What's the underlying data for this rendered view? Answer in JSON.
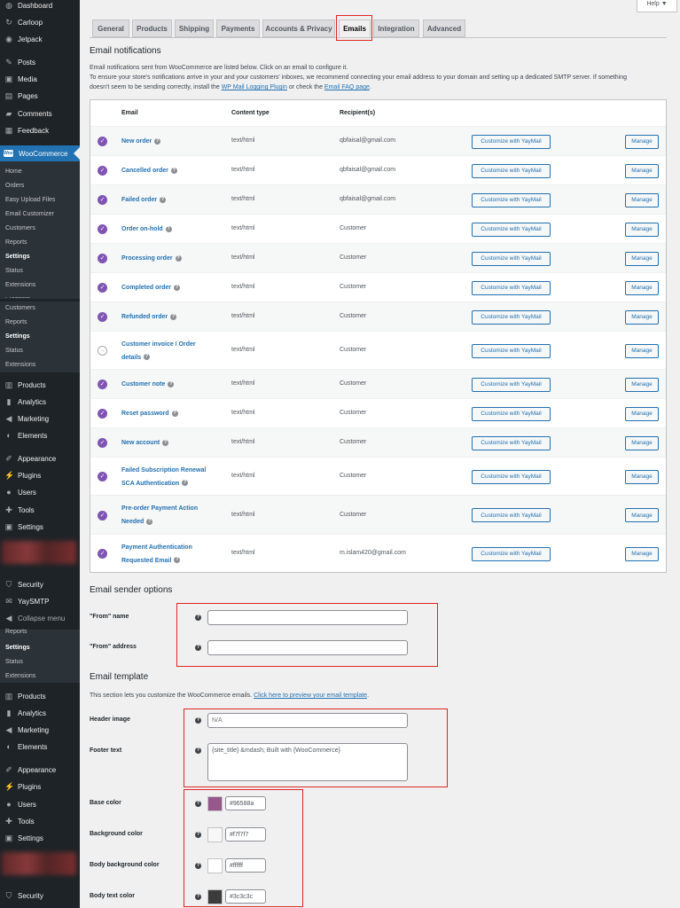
{
  "sidebar": {
    "dashboard": "Dashboard",
    "carloop": "Carloop",
    "jetpack": "Jetpack",
    "posts": "Posts",
    "media": "Media",
    "pages": "Pages",
    "comments": "Comments",
    "feedback": "Feedback",
    "woocommerce": "WooCommerce",
    "woo_icon": "Woo",
    "woo_sub": [
      "Home",
      "Orders",
      "Easy Upload Files",
      "Email Customizer",
      "Customers",
      "Reports",
      "Settings",
      "Status",
      "Extensions"
    ],
    "clip": "Products",
    "sub2": [
      "Customers",
      "Reports",
      "Settings",
      "Status",
      "Extensions"
    ],
    "menu2": [
      "Products",
      "Analytics",
      "Marketing",
      "Elements"
    ],
    "menu3": [
      "Appearance",
      "Plugins",
      "Users",
      "Tools",
      "Settings"
    ],
    "menu4": [
      "Security",
      "YaySMTP",
      "Collapse menu"
    ],
    "sub3": [
      "Reports",
      "Settings",
      "Status",
      "Extensions"
    ],
    "menu5": [
      "Products",
      "Analytics",
      "Marketing",
      "Elements"
    ],
    "menu6": [
      "Appearance",
      "Plugins",
      "Users",
      "Tools",
      "Settings"
    ],
    "security_bottom": "Security"
  },
  "help_label": "Help ▼",
  "tabs": [
    "General",
    "Products",
    "Shipping",
    "Payments",
    "Accounts & Privacy",
    "Emails",
    "Integration",
    "Advanced"
  ],
  "notifications": {
    "title": "Email notifications",
    "line1": "Email notifications sent from WooCommerce are listed below. Click on an email to configure it.",
    "line2": "To ensure your store's notifications arrive in your and your customers' inboxes, we recommend connecting your email address to your domain and setting up a dedicated SMTP server. If something",
    "line3_a": "doesn't seem to be sending correctly, install the ",
    "line3_link1": "WP Mail Logging Plugin",
    "line3_b": " or check the ",
    "line3_link2": "Email FAQ page",
    "line3_c": "."
  },
  "table": {
    "headers": {
      "email": "Email",
      "content_type": "Content type",
      "recipients": "Recipient(s)"
    },
    "yay_label": "Customize with YayMail",
    "manage_label": "Manage",
    "rows": [
      {
        "name1": "New order",
        "name2": "",
        "type": "text/html",
        "recipient": "qbfaisal@gmail.com",
        "enabled": true
      },
      {
        "name1": "Cancelled order",
        "name2": "",
        "type": "text/html",
        "recipient": "qbfaisal@gmail.com",
        "enabled": true
      },
      {
        "name1": "Failed order",
        "name2": "",
        "type": "text/html",
        "recipient": "qbfaisal@gmail.com",
        "enabled": true
      },
      {
        "name1": "Order on-hold",
        "name2": "",
        "type": "text/html",
        "recipient": "Customer",
        "enabled": true
      },
      {
        "name1": "Processing order",
        "name2": "",
        "type": "text/html",
        "recipient": "Customer",
        "enabled": true
      },
      {
        "name1": "Completed order",
        "name2": "",
        "type": "text/html",
        "recipient": "Customer",
        "enabled": true
      },
      {
        "name1": "Refunded order",
        "name2": "",
        "type": "text/html",
        "recipient": "Customer",
        "enabled": true
      },
      {
        "name1": "Customer invoice / Order",
        "name2": "details",
        "type": "text/html",
        "recipient": "Customer",
        "enabled": false
      },
      {
        "name1": "Customer note",
        "name2": "",
        "type": "text/html",
        "recipient": "Customer",
        "enabled": true
      },
      {
        "name1": "Reset password",
        "name2": "",
        "type": "text/html",
        "recipient": "Customer",
        "enabled": true
      },
      {
        "name1": "New account",
        "name2": "",
        "type": "text/html",
        "recipient": "Customer",
        "enabled": true
      },
      {
        "name1": "Failed Subscription Renewal",
        "name2": "SCA Authentication",
        "type": "text/html",
        "recipient": "Customer",
        "enabled": true
      },
      {
        "name1": "Pre-order Payment Action",
        "name2": "Needed",
        "type": "text/html",
        "recipient": "Customer",
        "enabled": true
      },
      {
        "name1": "Payment Authentication",
        "name2": "Requested Email",
        "type": "text/html",
        "recipient": "m.islam420@gmail.com",
        "enabled": true
      }
    ]
  },
  "sender": {
    "title": "Email sender options",
    "from_name_label": "\"From\" name",
    "from_name_value": "",
    "from_address_label": "\"From\" address",
    "from_address_value": ""
  },
  "template": {
    "title": "Email template",
    "desc": "This section lets you customize the WooCommerce emails. ",
    "preview_link": "Click here to preview your email template",
    "desc_end": ".",
    "header_image_label": "Header image",
    "header_image_placeholder": "N/A",
    "footer_text_label": "Footer text",
    "footer_text_value": "{site_title} &mdash; Built with {WooCommerce}",
    "base_color_label": "Base color",
    "base_color": "#96588a",
    "background_color_label": "Background color",
    "background_color": "#f7f7f7",
    "body_bg_label": "Body background color",
    "body_bg": "#ffffff",
    "body_text_label": "Body text color",
    "body_text": "#3c3c3c"
  },
  "colors": {
    "accent": "#2271b1",
    "sidebar": "#1d2327",
    "woo_purple": "#7f54b3",
    "highlight": "#e02424"
  }
}
